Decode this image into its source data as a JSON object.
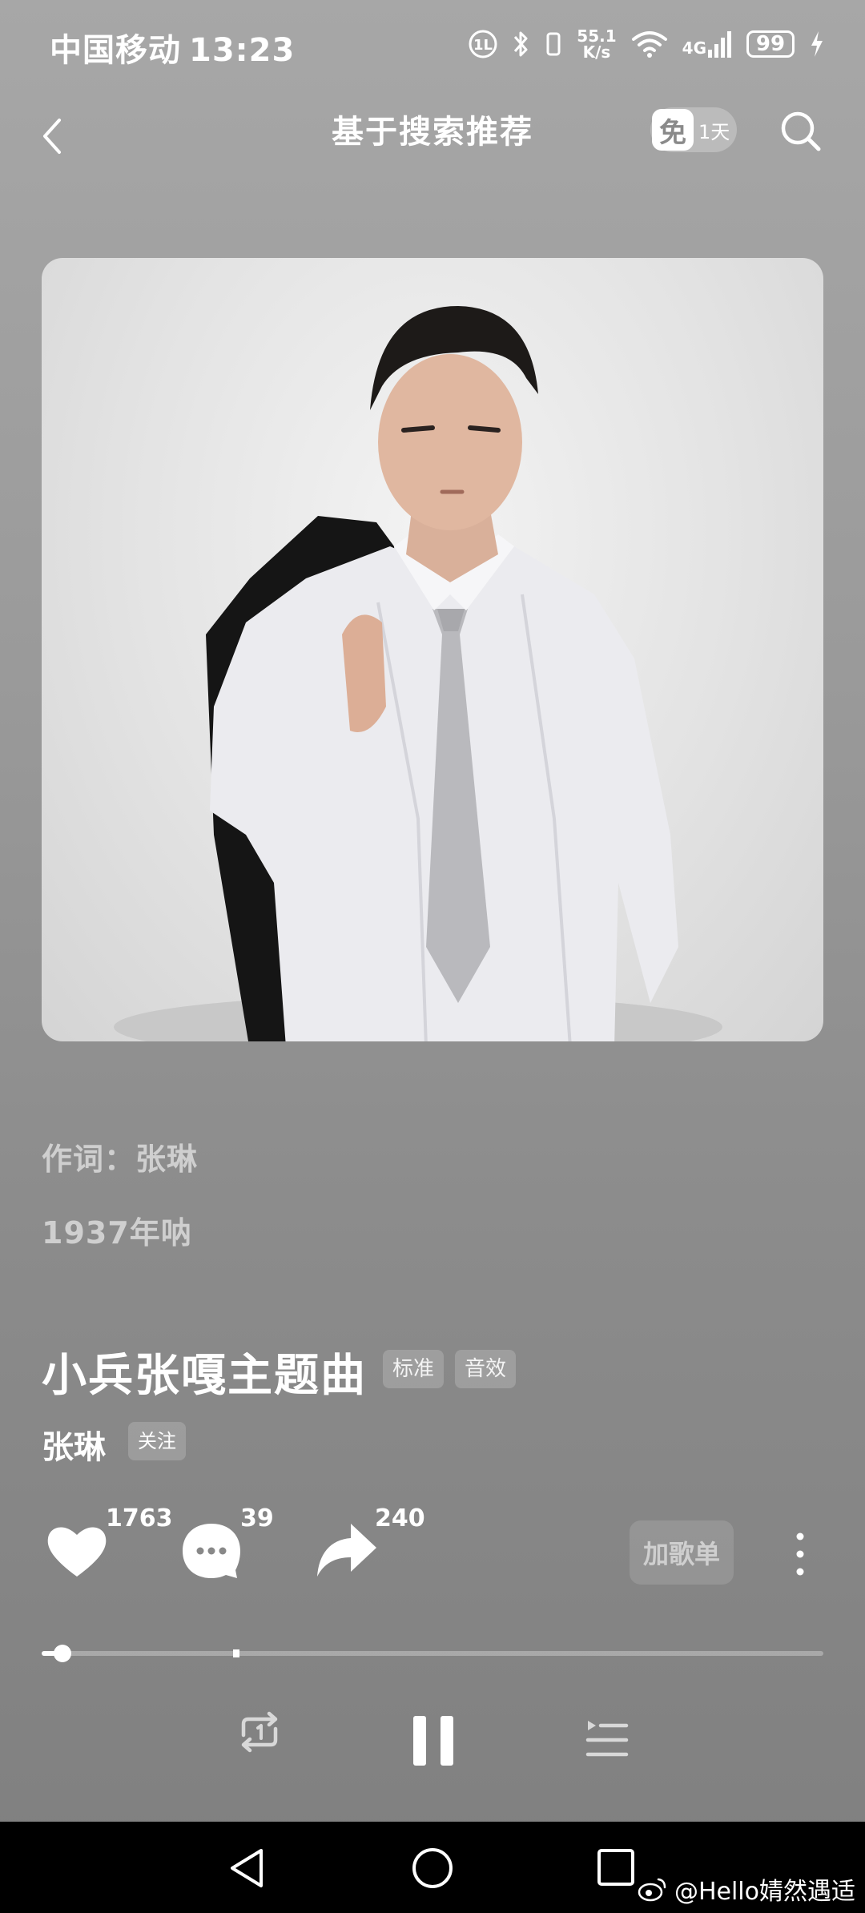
{
  "status_bar": {
    "carrier": "中国移动",
    "time": "13:23",
    "net_speed_value": "55.1",
    "net_speed_unit": "K/s",
    "network_type": "4G",
    "battery": "99"
  },
  "header": {
    "title": "基于搜索推荐",
    "free_icon_text": "免",
    "free_days": "1天"
  },
  "lyrics": {
    "line1": "作词：张琳",
    "line2": "1937年呐"
  },
  "song": {
    "title": "小兵张嘎主题曲",
    "tags": [
      "标准",
      "音效"
    ],
    "artist": "张琳",
    "follow_label": "关注"
  },
  "actions": {
    "like_count": "1763",
    "comment_count": "39",
    "share_count": "240",
    "add_playlist_label": "加歌单"
  },
  "playback": {
    "progress": 0.02,
    "buffered": 0.245,
    "state": "playing"
  },
  "watermark": "@Hello婧然遇适",
  "colors": {
    "background": "#9a9a9a",
    "navbar": "#000000",
    "text": "#ffffff",
    "muted_text": "#cfcfcf"
  }
}
